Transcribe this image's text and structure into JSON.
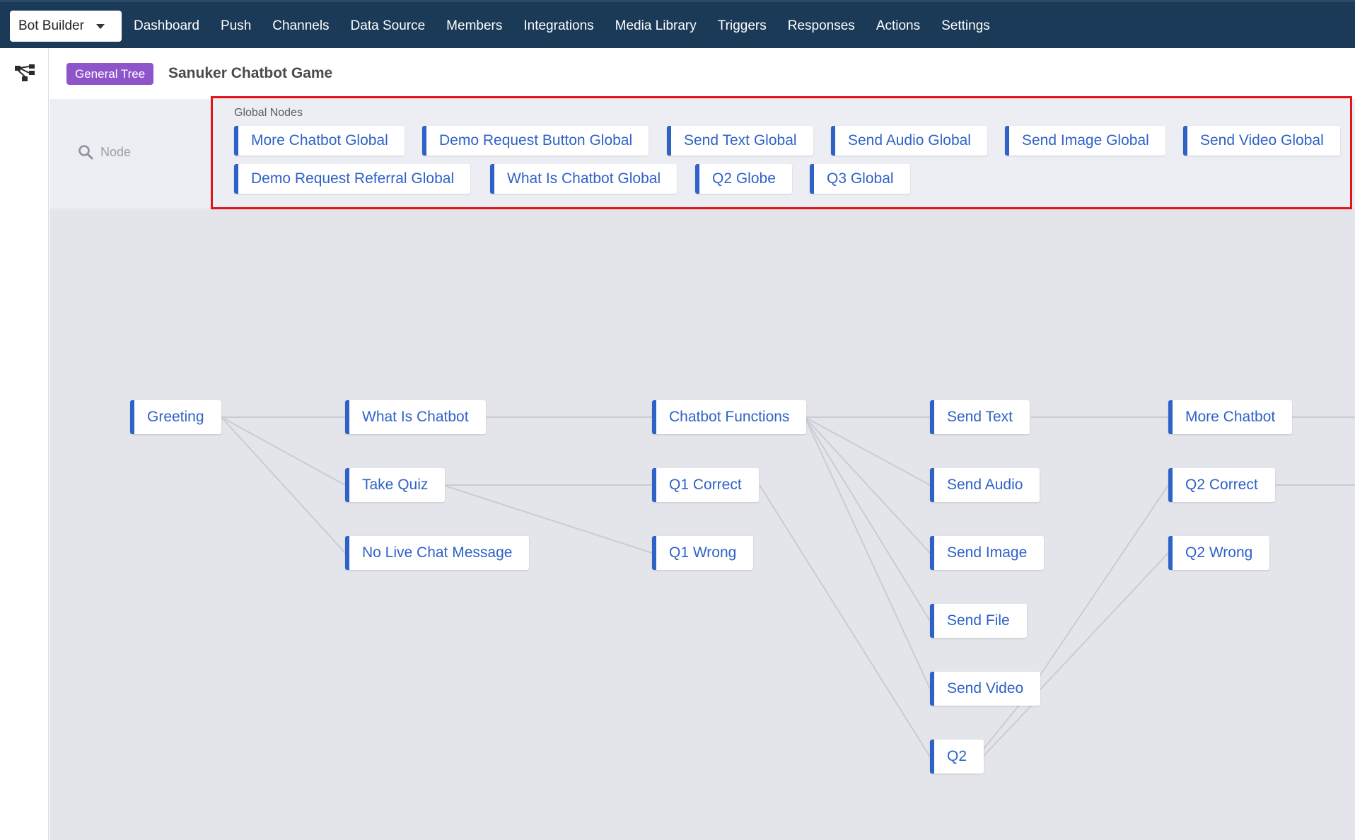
{
  "app": {
    "selector_label": "Bot Builder"
  },
  "nav": {
    "items": [
      "Dashboard",
      "Push",
      "Channels",
      "Data Source",
      "Members",
      "Integrations",
      "Media Library",
      "Triggers",
      "Responses",
      "Actions",
      "Settings"
    ]
  },
  "header": {
    "badge": "General Tree",
    "title": "Sanuker Chatbot Game"
  },
  "search": {
    "placeholder": "Node"
  },
  "global_nodes": {
    "label": "Global Nodes",
    "items": [
      "More Chatbot Global",
      "Demo Request Button Global",
      "Send Text Global",
      "Send Audio Global",
      "Send Image Global",
      "Send Video Global",
      "Demo Request Referral Global",
      "What Is Chatbot Global",
      "Q2 Globe",
      "Q3 Global"
    ]
  },
  "tree": {
    "nodes": [
      "Greeting",
      "What Is Chatbot",
      "Take Quiz",
      "No Live Chat Message",
      "Chatbot Functions",
      "Q1 Correct",
      "Q1 Wrong",
      "Send Text",
      "Send Audio",
      "Send Image",
      "Send File",
      "Send Video",
      "Q2",
      "More Chatbot",
      "Q2 Correct",
      "Q2 Wrong"
    ]
  },
  "colors": {
    "nav_bg": "#1b3a57",
    "accent": "#2f62c7",
    "badge": "#8e54c9",
    "highlight": "#e0161b",
    "canvas": "#e3e5ea"
  }
}
